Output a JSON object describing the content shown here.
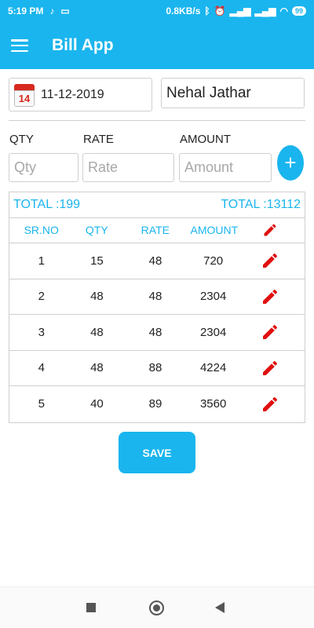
{
  "status_bar": {
    "time": "5:19 PM",
    "network_speed": "0.8KB/s",
    "battery": "99",
    "icons": [
      "tiktok-icon",
      "laptop-icon",
      "bluetooth-icon",
      "alarm-icon",
      "volte-icon",
      "signal-icon",
      "wifi-icon",
      "battery-icon"
    ]
  },
  "app_bar": {
    "title": "Bill App",
    "menu_icon": "hamburger-menu-icon"
  },
  "header": {
    "calendar_day": "14",
    "date": "11-12-2019",
    "customer_name": "Nehal Jathar"
  },
  "entry": {
    "qty_label": "QTY",
    "rate_label": "RATE",
    "amount_label": "AMOUNT",
    "qty_placeholder": "Qty",
    "rate_placeholder": "Rate",
    "amount_placeholder": "Amount",
    "add_label": "+"
  },
  "totals": {
    "total_qty": "TOTAL :199",
    "total_amount": "TOTAL :13112"
  },
  "table": {
    "headers": [
      "SR.NO",
      "QTY",
      "RATE",
      "AMOUNT"
    ],
    "rows": [
      {
        "srno": "1",
        "qty": "15",
        "rate": "48",
        "amount": "720"
      },
      {
        "srno": "2",
        "qty": "48",
        "rate": "48",
        "amount": "2304"
      },
      {
        "srno": "3",
        "qty": "48",
        "rate": "48",
        "amount": "2304"
      },
      {
        "srno": "4",
        "qty": "48",
        "rate": "88",
        "amount": "4224"
      },
      {
        "srno": "5",
        "qty": "40",
        "rate": "89",
        "amount": "3560"
      }
    ]
  },
  "save_label": "SAVE",
  "colors": {
    "accent": "#1ab5ee",
    "edit_icon": "#e01010"
  }
}
